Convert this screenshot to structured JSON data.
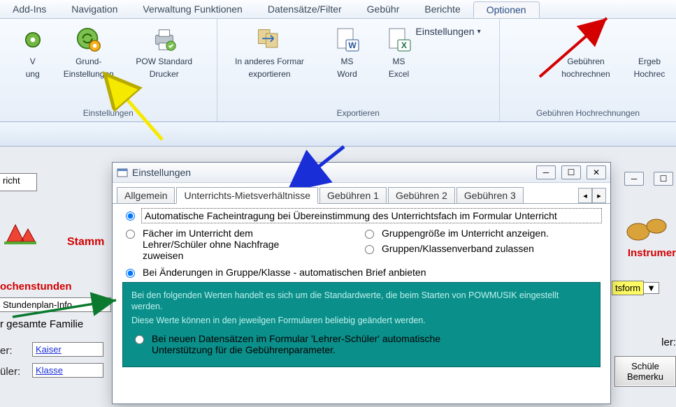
{
  "menu": {
    "tabs": [
      "Add-Ins",
      "Navigation",
      "Verwaltung Funktionen",
      "Datensätze/Filter",
      "Gebühr",
      "Berichte",
      "Optionen"
    ],
    "active": "Optionen"
  },
  "ribbon": {
    "group1": {
      "title": "Einstellungen",
      "btn0": {
        "l1": "V",
        "l2": "ung"
      },
      "btn1": {
        "l1": "Grund-",
        "l2": "Einstellungen"
      },
      "btn2": {
        "l1": "POW Standard",
        "l2": "Drucker"
      }
    },
    "group2": {
      "title": "Exportieren",
      "btn1": {
        "l1": "In anderes Formar",
        "l2": "exportieren"
      },
      "btn2": {
        "l1": "MS",
        "l2": "Word"
      },
      "btn3": {
        "l1": "MS",
        "l2": "Excel"
      },
      "dropdown": "Einstellungen"
    },
    "group3": {
      "title": "Gebühren Hochrechnungen",
      "btn1": {
        "l1": "Gebühren",
        "l2": "hochrechnen"
      },
      "btn2": {
        "l1": "Ergeb",
        "l2": "Hochrec"
      }
    }
  },
  "dialog": {
    "title": "Einstellungen",
    "tabs": [
      "Allgemein",
      "Unterrichts-Mietsverhältnisse",
      "Gebühren 1",
      "Gebühren 2",
      "Gebühren 3"
    ],
    "activeTab": "Unterrichts-Mietsverhältnisse",
    "opt1": "Automatische Facheintragung bei Übereinstimmung des Unterrichtsfach im Formular Unterricht",
    "opt2": "Fächer im Unterricht dem Lehrer/Schüler ohne Nachfrage zuweisen",
    "opt3": "Gruppengröße im Unterricht anzeigen.",
    "opt4": "Gruppen/Klassenverband zulassen",
    "opt5": "Bei Änderungen in Gruppe/Klasse - automatischen Brief anbieten",
    "note1": "Bei den folgenden Werten handelt es sich um die Standardwerte, die beim Starten von POWMUSIK eingestellt werden.",
    "note2": "Diese Werte können in den jeweilgen Formularen beliebig geändert werden.",
    "opt6": "Bei neuen Datensätzen im Formular 'Lehrer-Schüler' automatische Unterstützung für die Gebührenparameter."
  },
  "bg": {
    "richt": "richt",
    "stamm": "Stamm",
    "instrument": "Instrumer",
    "ochenstunden": "ochenstunden",
    "stundenplan": "Stundenplan-Info",
    "familie": "r gesamte Familie",
    "er": "er:",
    "uler": "üler:",
    "kaiser": "Kaiser",
    "klasse": "Klasse",
    "tsform": "tsform",
    "ler": "ler:",
    "schule": "Schüle",
    "bemerk": "Bemerku"
  }
}
